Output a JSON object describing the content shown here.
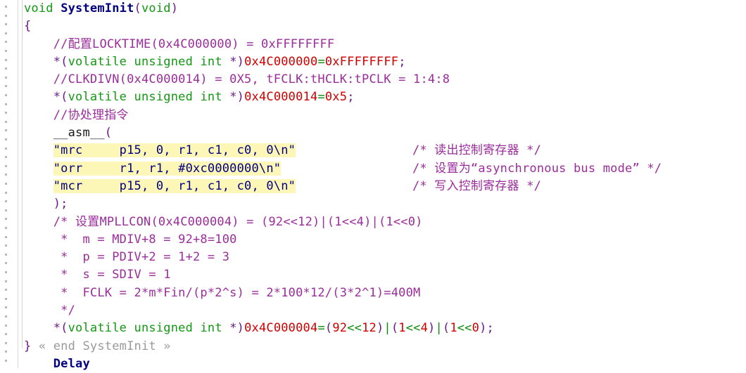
{
  "editor": {
    "language": "C",
    "background": "#ffffff",
    "highlight_color": "#fcf7b6",
    "gutter_dot_color": "#b9b9b9",
    "colors": {
      "keyword": "#119911",
      "function_name": "#000080",
      "punctuation": "#6a1a8a",
      "comment": "#9b2d9b",
      "number": "#d00000",
      "operator": "#0b8a0b",
      "string": "#000080",
      "fold_note": "#9a9a9a"
    }
  },
  "lines": [
    {
      "n": 1,
      "tokens": [
        {
          "t": "void ",
          "c": "kw"
        },
        {
          "t": "SystemInit",
          "c": "fnname"
        },
        {
          "t": "(",
          "c": "punct"
        },
        {
          "t": "void",
          "c": "kw"
        },
        {
          "t": ")",
          "c": "punct"
        }
      ]
    },
    {
      "n": 2,
      "tokens": [
        {
          "t": "{",
          "c": "punct"
        }
      ]
    },
    {
      "n": 3,
      "tokens": [
        {
          "t": "    //配置LOCKTIME(0x4C000000) = 0xFFFFFFFF",
          "c": "comment"
        }
      ]
    },
    {
      "n": 4,
      "tokens": [
        {
          "t": "    ",
          "c": "plain"
        },
        {
          "t": "*(",
          "c": "punct"
        },
        {
          "t": "volatile unsigned int",
          "c": "kw"
        },
        {
          "t": " *)",
          "c": "punct"
        },
        {
          "t": "0x4C000000",
          "c": "num"
        },
        {
          "t": "=",
          "c": "op"
        },
        {
          "t": "0xFFFFFFFF",
          "c": "num"
        },
        {
          "t": ";",
          "c": "punct"
        }
      ]
    },
    {
      "n": 5,
      "tokens": [
        {
          "t": "    //CLKDIVN(0x4C000014) = 0X5, tFCLK:tHCLK:tPCLK = 1:4:8",
          "c": "comment"
        }
      ]
    },
    {
      "n": 6,
      "tokens": [
        {
          "t": "    ",
          "c": "plain"
        },
        {
          "t": "*(",
          "c": "punct"
        },
        {
          "t": "volatile unsigned int",
          "c": "kw"
        },
        {
          "t": " *)",
          "c": "punct"
        },
        {
          "t": "0x4C000014",
          "c": "num"
        },
        {
          "t": "=",
          "c": "op"
        },
        {
          "t": "0x5",
          "c": "num"
        },
        {
          "t": ";",
          "c": "punct"
        }
      ]
    },
    {
      "n": 7,
      "tokens": [
        {
          "t": "    //协处理指令",
          "c": "comment"
        }
      ]
    },
    {
      "n": 8,
      "tokens": [
        {
          "t": "    ",
          "c": "plain"
        },
        {
          "t": "__asm__",
          "c": "plain"
        },
        {
          "t": "(",
          "c": "punct"
        }
      ]
    },
    {
      "n": 9,
      "highlight": true,
      "tokens": [
        {
          "t": "    ",
          "c": "plain"
        },
        {
          "t": "\"mrc     p15, 0, r1, c1, c0, 0\\n\"",
          "c": "str",
          "hl": true
        }
      ],
      "comment": "/* 读出控制寄存器 */"
    },
    {
      "n": 10,
      "highlight": true,
      "tokens": [
        {
          "t": "    ",
          "c": "plain"
        },
        {
          "t": "\"orr     r1, r1, #0xc0000000\\n\"",
          "c": "str",
          "hl": true
        }
      ],
      "comment": "/* 设置为“asynchronous bus mode” */"
    },
    {
      "n": 11,
      "highlight": true,
      "tokens": [
        {
          "t": "    ",
          "c": "plain"
        },
        {
          "t": "\"mcr     p15, 0, r1, c1, c0, 0\\n\"",
          "c": "str",
          "hl": true
        }
      ],
      "comment": "/* 写入控制寄存器 */"
    },
    {
      "n": 12,
      "tokens": [
        {
          "t": "    ",
          "c": "plain"
        },
        {
          "t": ");",
          "c": "punct"
        }
      ]
    },
    {
      "n": 13,
      "tokens": [
        {
          "t": "    /* 设置MPLLCON(0x4C000004) = (92<<12)|(1<<4)|(1<<0)",
          "c": "comment"
        }
      ]
    },
    {
      "n": 14,
      "tokens": [
        {
          "t": "     *  m = MDIV+8 = 92+8=100",
          "c": "comment"
        }
      ]
    },
    {
      "n": 15,
      "tokens": [
        {
          "t": "     *  p = PDIV+2 = 1+2 = 3",
          "c": "comment"
        }
      ]
    },
    {
      "n": 16,
      "tokens": [
        {
          "t": "     *  s = SDIV = 1",
          "c": "comment"
        }
      ]
    },
    {
      "n": 17,
      "tokens": [
        {
          "t": "     *  FCLK = 2*m*Fin/(p*2^s) = 2*100*12/(3*2^1)=400M",
          "c": "comment"
        }
      ]
    },
    {
      "n": 18,
      "tokens": [
        {
          "t": "     */",
          "c": "comment"
        }
      ]
    },
    {
      "n": 19,
      "tokens": [
        {
          "t": "    ",
          "c": "plain"
        },
        {
          "t": "*(",
          "c": "punct"
        },
        {
          "t": "volatile unsigned int",
          "c": "kw"
        },
        {
          "t": " *)",
          "c": "punct"
        },
        {
          "t": "0x4C000004",
          "c": "num"
        },
        {
          "t": "=",
          "c": "op"
        },
        {
          "t": "(",
          "c": "punct"
        },
        {
          "t": "92",
          "c": "num"
        },
        {
          "t": "<<",
          "c": "op"
        },
        {
          "t": "12",
          "c": "num"
        },
        {
          "t": ")",
          "c": "punct"
        },
        {
          "t": "|",
          "c": "op"
        },
        {
          "t": "(",
          "c": "punct"
        },
        {
          "t": "1",
          "c": "num"
        },
        {
          "t": "<<",
          "c": "op"
        },
        {
          "t": "4",
          "c": "num"
        },
        {
          "t": ")",
          "c": "punct"
        },
        {
          "t": "|",
          "c": "op"
        },
        {
          "t": "(",
          "c": "punct"
        },
        {
          "t": "1",
          "c": "num"
        },
        {
          "t": "<<",
          "c": "op"
        },
        {
          "t": "0",
          "c": "num"
        },
        {
          "t": ");",
          "c": "punct"
        }
      ]
    },
    {
      "n": 20,
      "tokens": [
        {
          "t": "}",
          "c": "punct"
        },
        {
          "t": " ",
          "c": "plain"
        },
        {
          "t": "« end SystemInit »",
          "c": "fold-note"
        }
      ]
    },
    {
      "n": 21,
      "partial": true,
      "tokens": [
        {
          "t": "    ",
          "c": "plain"
        },
        {
          "t": "Delay",
          "c": "partial"
        }
      ]
    }
  ]
}
